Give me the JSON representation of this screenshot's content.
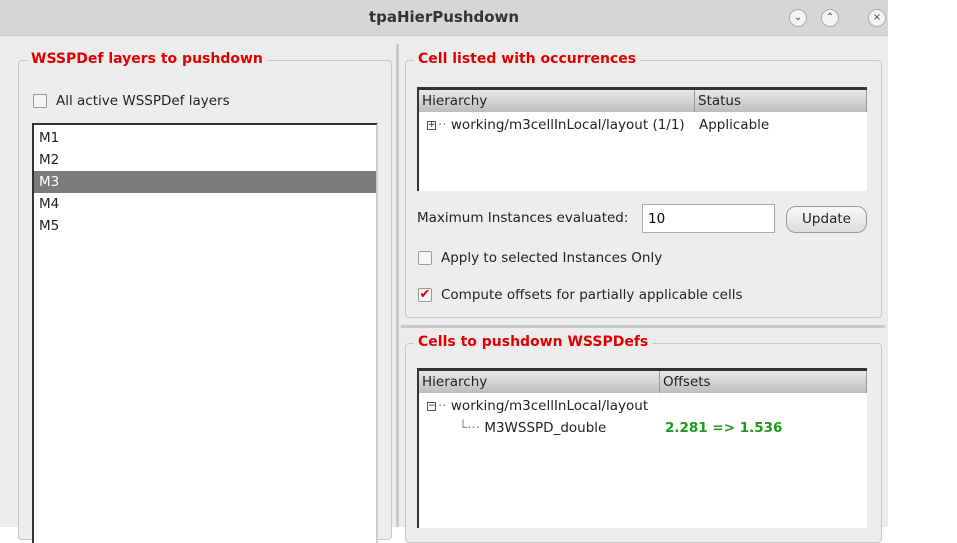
{
  "window": {
    "title": "tpaHierPushdown",
    "minimize": "⌄",
    "maximize": "⌃",
    "close": "×"
  },
  "left": {
    "title": "WSSPDef layers to pushdown",
    "all_active_label": "All active WSSPDef layers",
    "all_active_checked": false,
    "layers": [
      "M1",
      "M2",
      "M3",
      "M4",
      "M5"
    ],
    "selected": "M3"
  },
  "occurrences": {
    "title": "Cell listed with occurrences",
    "columns": [
      "Hierarchy",
      "Status"
    ],
    "rows": [
      {
        "hierarchy": "working/m3cellInLocal/layout (1/1)",
        "status": "Applicable"
      }
    ],
    "max_label": "Maximum Instances evaluated:",
    "max_value": "10",
    "update_label": "Update",
    "apply_selected_label": "Apply to selected Instances Only",
    "apply_selected_checked": false,
    "compute_offsets_label": "Compute offsets for partially applicable cells",
    "compute_offsets_checked": true
  },
  "pushdown": {
    "title": "Cells to pushdown WSSPDefs",
    "columns": [
      "Hierarchy",
      "Offsets"
    ],
    "parent": "working/m3cellInLocal/layout",
    "child": "M3WSSPD_double",
    "offset": "2.281 => 1.536"
  },
  "colors": {
    "group_title": "#e00000",
    "offset": "#1a9a1a",
    "check": "#d40000"
  }
}
